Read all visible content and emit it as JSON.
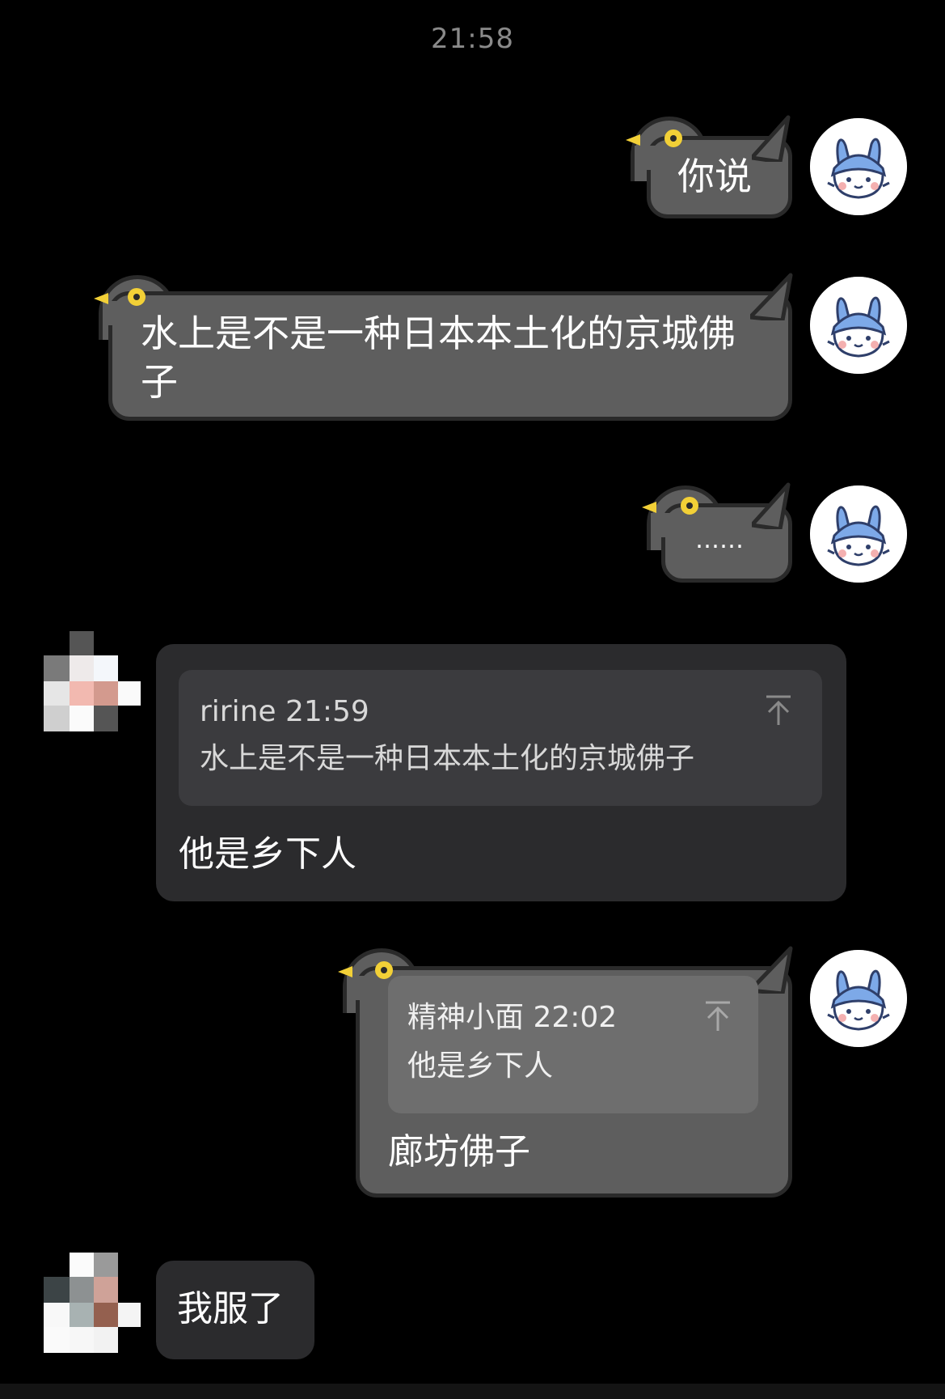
{
  "time_divider": "21:58",
  "messages": [
    {
      "side": "me",
      "text": "你说"
    },
    {
      "side": "me",
      "text_line1": "水上是不是一种日本本土化的京城佛",
      "text_line2": "子"
    },
    {
      "side": "me",
      "text": "……"
    },
    {
      "side": "other",
      "quote": {
        "author_time": "ririne 21:59",
        "text": "水上是不是一种日本本土化的京城佛子"
      },
      "text": "他是乡下人"
    },
    {
      "side": "me",
      "quote": {
        "author_time": "精神小面 22:02",
        "text": "他是乡下人"
      },
      "text": "廊坊佛子"
    },
    {
      "side": "other",
      "text": "我服了"
    }
  ],
  "icons": {
    "my_avatar": "bunny-avatar-icon",
    "other_avatar": "pixelated-avatar-icon",
    "quote_jump": "jump-to-top-icon"
  },
  "colors": {
    "background": "#000000",
    "bird_bubble": "#5e5e5e",
    "bird_outline": "#2a2a2a",
    "bird_eye": "#f2d037",
    "incoming_bubble": "#2b2b2d",
    "incoming_quote": "#3b3b3e",
    "outgoing_quote": "#6e6e6e"
  }
}
